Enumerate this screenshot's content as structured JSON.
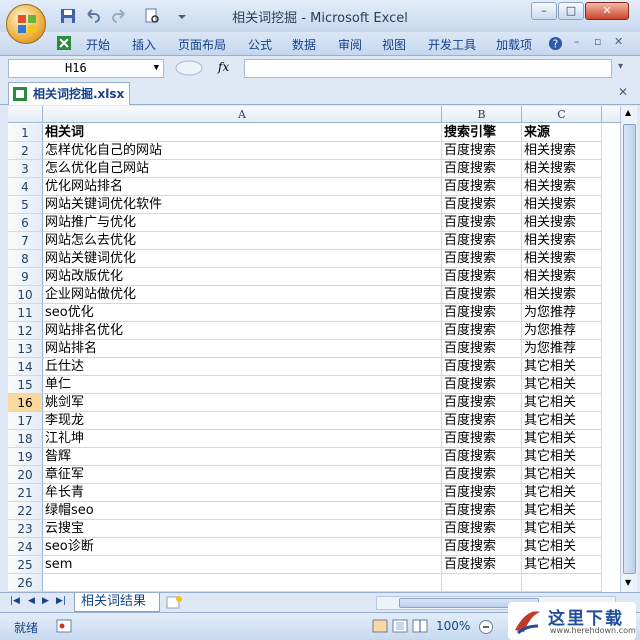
{
  "window": {
    "title": "相关词挖掘 - Microsoft Excel",
    "minimize": "–",
    "maximize": "□",
    "close": "✕"
  },
  "ribbon": {
    "tabs": [
      "开始",
      "插入",
      "页面布局",
      "公式",
      "数据",
      "审阅",
      "视图",
      "开发工具",
      "加载项"
    ]
  },
  "formula_bar": {
    "name_box": "H16",
    "fx": "fx",
    "formula": ""
  },
  "document": {
    "tab_name": "相关词挖掘.xlsx"
  },
  "sheet": {
    "columns": [
      "A",
      "B",
      "C"
    ],
    "selected_row": 16,
    "rows": [
      {
        "n": "1",
        "a": "相关词",
        "b": "搜索引擎",
        "c": "来源"
      },
      {
        "n": "2",
        "a": "怎样优化自己的网站",
        "b": "百度搜索",
        "c": "相关搜索"
      },
      {
        "n": "3",
        "a": "怎么优化自己网站",
        "b": "百度搜索",
        "c": "相关搜索"
      },
      {
        "n": "4",
        "a": "优化网站排名",
        "b": "百度搜索",
        "c": "相关搜索"
      },
      {
        "n": "5",
        "a": "网站关键词优化软件",
        "b": "百度搜索",
        "c": "相关搜索"
      },
      {
        "n": "6",
        "a": "网站推广与优化",
        "b": "百度搜索",
        "c": "相关搜索"
      },
      {
        "n": "7",
        "a": "网站怎么去优化",
        "b": "百度搜索",
        "c": "相关搜索"
      },
      {
        "n": "8",
        "a": "网站关键词优化",
        "b": "百度搜索",
        "c": "相关搜索"
      },
      {
        "n": "9",
        "a": "网站改版优化",
        "b": "百度搜索",
        "c": "相关搜索"
      },
      {
        "n": "10",
        "a": "企业网站做优化",
        "b": "百度搜索",
        "c": "相关搜索"
      },
      {
        "n": "11",
        "a": "seo优化",
        "b": "百度搜索",
        "c": "为您推荐"
      },
      {
        "n": "12",
        "a": "网站排名优化",
        "b": "百度搜索",
        "c": "为您推荐"
      },
      {
        "n": "13",
        "a": "网站排名",
        "b": "百度搜索",
        "c": "为您推荐"
      },
      {
        "n": "14",
        "a": "丘仕达",
        "b": "百度搜索",
        "c": "其它相关"
      },
      {
        "n": "15",
        "a": "单仁",
        "b": "百度搜索",
        "c": "其它相关"
      },
      {
        "n": "16",
        "a": "姚剑军",
        "b": "百度搜索",
        "c": "其它相关"
      },
      {
        "n": "17",
        "a": "李现龙",
        "b": "百度搜索",
        "c": "其它相关"
      },
      {
        "n": "18",
        "a": "江礼坤",
        "b": "百度搜索",
        "c": "其它相关"
      },
      {
        "n": "19",
        "a": "昝辉",
        "b": "百度搜索",
        "c": "其它相关"
      },
      {
        "n": "20",
        "a": "章征军",
        "b": "百度搜索",
        "c": "其它相关"
      },
      {
        "n": "21",
        "a": "牟长青",
        "b": "百度搜索",
        "c": "其它相关"
      },
      {
        "n": "22",
        "a": "绿帽seo",
        "b": "百度搜索",
        "c": "其它相关"
      },
      {
        "n": "23",
        "a": "云搜宝",
        "b": "百度搜索",
        "c": "其它相关"
      },
      {
        "n": "24",
        "a": "seo诊断",
        "b": "百度搜索",
        "c": "其它相关"
      },
      {
        "n": "25",
        "a": "sem",
        "b": "百度搜索",
        "c": "其它相关"
      },
      {
        "n": "26",
        "a": "",
        "b": "",
        "c": ""
      }
    ]
  },
  "sheet_tabs": {
    "active": "相关词结果"
  },
  "status": {
    "ready": "就绪",
    "zoom": "100%"
  },
  "watermark": {
    "text": "这里下载",
    "url": "www.herehdown.com"
  },
  "colors": {
    "frame": "#dfe8f5",
    "selected_row_header": "#f9d99f",
    "grid_line": "#d0d7e5"
  }
}
